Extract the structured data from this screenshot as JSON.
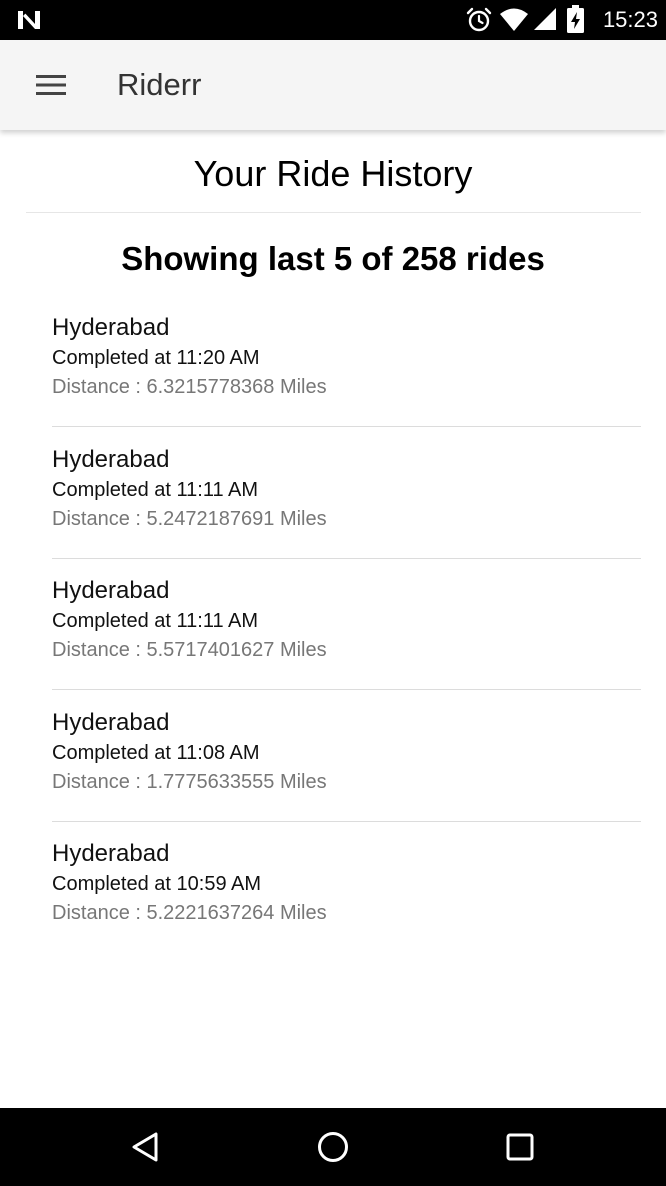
{
  "status_bar": {
    "time": "15:23",
    "icons": [
      "n-logo-icon",
      "alarm-icon",
      "wifi-icon",
      "signal-icon",
      "battery-charging-icon"
    ]
  },
  "app_bar": {
    "title": "Riderr",
    "menu_icon": "hamburger-menu-icon"
  },
  "page": {
    "title": "Your Ride History",
    "summary": "Showing last 5 of 258 rides"
  },
  "rides": [
    {
      "city": "Hyderabad",
      "completed": "Completed at 11:20 AM",
      "distance": "Distance : 6.3215778368 Miles"
    },
    {
      "city": "Hyderabad",
      "completed": "Completed at 11:11 AM",
      "distance": "Distance : 5.2472187691 Miles"
    },
    {
      "city": "Hyderabad",
      "completed": "Completed at 11:11 AM",
      "distance": "Distance : 5.5717401627 Miles"
    },
    {
      "city": "Hyderabad",
      "completed": "Completed at 11:08 AM",
      "distance": "Distance : 1.7775633555 Miles"
    },
    {
      "city": "Hyderabad",
      "completed": "Completed at 10:59 AM",
      "distance": "Distance : 5.2221637264 Miles"
    }
  ],
  "nav_bar": {
    "icons": [
      "back-icon",
      "home-icon",
      "recents-icon"
    ]
  },
  "colors": {
    "app_bar_bg": "#f5f5f5",
    "secondary_text": "#777777",
    "divider": "#dcdcdc"
  }
}
